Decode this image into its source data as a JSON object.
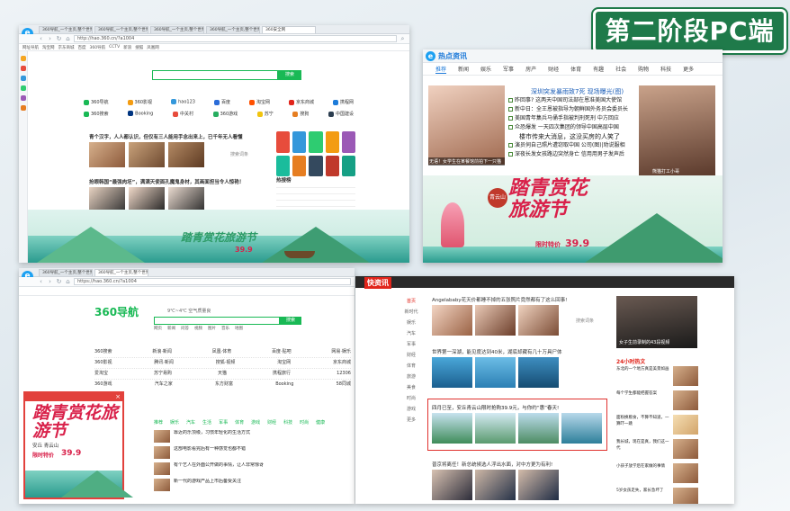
{
  "stage_label": "第二阶段PC端",
  "browser_tl": {
    "tabs": [
      "360导航_一个主页,整个世界",
      "360导航_一个主页,整个世界",
      "360导航_一个主页,整个世界",
      "360导航_一个主页,整个世界",
      "360安全网"
    ],
    "url": "http://hao.360.cn/?a1004",
    "search_btn": "搜索",
    "favorites": [
      "网址导航",
      "淘宝网",
      "京东商城",
      "百度",
      "360导航",
      "CCTV",
      "新浪",
      "搜狐",
      "凤凰网"
    ],
    "links_row1": [
      "360导航",
      "360影视",
      "hao123",
      "百度",
      "淘宝网",
      "京东商城",
      "携程网"
    ],
    "links_row2": [
      "360搜索",
      "Booking",
      "中关村",
      "360游戏",
      "苏宁",
      "搜狗",
      "中国建设"
    ],
    "headline1": "青个汉字，人人都认识，但仅有三人能用手念出来上，已千年无人看懂",
    "headline2": "抢眼韩国“最强肉坯”，满满天使面孔魔鬼身材，其画面担当令人惊艳！",
    "ad_link": "搜索词条",
    "hot_title": "热搜榜",
    "banner_text": "踏青赏花旅游节",
    "price": "39.9"
  },
  "browser_tr": {
    "brand": "热点资讯",
    "nav": [
      "推荐",
      "新闻",
      "娱乐",
      "军事",
      "房产",
      "财经",
      "体育",
      "有趣",
      "社会",
      "购物",
      "科技",
      "更多"
    ],
    "headline_main": "深圳突发暴雨致7死 现场曝光(图)",
    "news": [
      "昨回事? 这两天中国司法部在恩准美国大使馆",
      "新中日：全王恩被指导为朝鲜国外务员会委员长",
      "美国青年集兵马俑手指被判刑死刑 中方回应",
      "众恐爆发 一天四次集团的领导中国高层中国",
      "楼市传来大消息，这没买房的人笑了",
      "演员伺自己照片遭窃取中国 公司(图)|劝说服相",
      "深夜长发女孩路边突然身亡 信用用男子发声后"
    ],
    "caption_left": "无语！女学生在某餐馆前拍下一只猫",
    "caption_right": "熊猫打工小哥",
    "banner_text": "踏青赏花旅游节",
    "banner_sub": "青云山",
    "banner_limit": "限时特价",
    "price": "39.9"
  },
  "browser_bl": {
    "tabs": [
      "360导航_一个主页,整个世界",
      "360导航_一个主页,整个世界"
    ],
    "url": "https://hao.360.cn/?a1004",
    "logo": "360导航",
    "weather": "9℃~4℃ 空气质量良",
    "search_btn": "搜索",
    "search_tabs": [
      "网页",
      "新闻",
      "问答",
      "视频",
      "图片",
      "音乐",
      "地图",
      "良医",
      "购物"
    ],
    "nav_cells": [
      [
        "360搜索",
        "新浪·新闻",
        "凤凰·体育",
        "百度·贴吧",
        "网易·娱乐"
      ],
      [
        "360影视",
        "腾讯·新闻",
        "搜狐·视频",
        "淘宝网",
        "京东商城"
      ],
      [
        "爱淘宝",
        "苏宁易购",
        "天猫",
        "携程旅行",
        "12306"
      ],
      [
        "360游戏",
        "汽车之家",
        "东方财富",
        "Booking",
        "58同城"
      ]
    ],
    "feed_tabs": [
      "推荐",
      "娱乐",
      "汽车",
      "生活",
      "军事",
      "体育",
      "游戏",
      "财经",
      "科技",
      "时尚",
      "健康"
    ],
    "feed_items": [
      "靠近的乐顶级，习惯年轻化的生活方式",
      "这部电影看完后有一种感觉也都不错",
      "有个艺人在外面公开做的事情，让人非常惊讶",
      "新一代的游戏产品上市后备受关注"
    ],
    "popup_banner": "踏青赏花旅游节",
    "popup_limit": "限时特价",
    "popup_price": "39.9",
    "popup_sub": "安丘 青云山"
  },
  "browser_br": {
    "brand": "快资讯",
    "sidebar": [
      "首页",
      "新时代",
      "娱乐",
      "汽车",
      "军事",
      "财经",
      "体育",
      "旅游",
      "美食",
      "时尚",
      "游戏",
      "更多"
    ],
    "headline1": "Angelababy花天价都睡不掉的五张照片竟然都有了这么回事!",
    "headline2": "世界第一深湖，能见度达到40米，湖底却藏有几十万具尸体",
    "headline3": "四月已至，安丘青云山限时抢购39.9元，与你约“惠”春天!",
    "headline4": "普京将离任！新总统候选人浮出水面，对中方更为有利!",
    "ad_link": "搜索词条",
    "right_title": "24小时热文",
    "right_caption": "女子生前录制的43段视频",
    "right_items": [
      "东北的一个地方真是美景如画",
      "每个学生都能把握答案",
      "面粉换粮食，不算不知道，一算吓一跳",
      "我长城，现在是真，我们这一代",
      "小孩子放学后在家做的事情",
      "5岁女孩走失，家长急坏了"
    ]
  }
}
